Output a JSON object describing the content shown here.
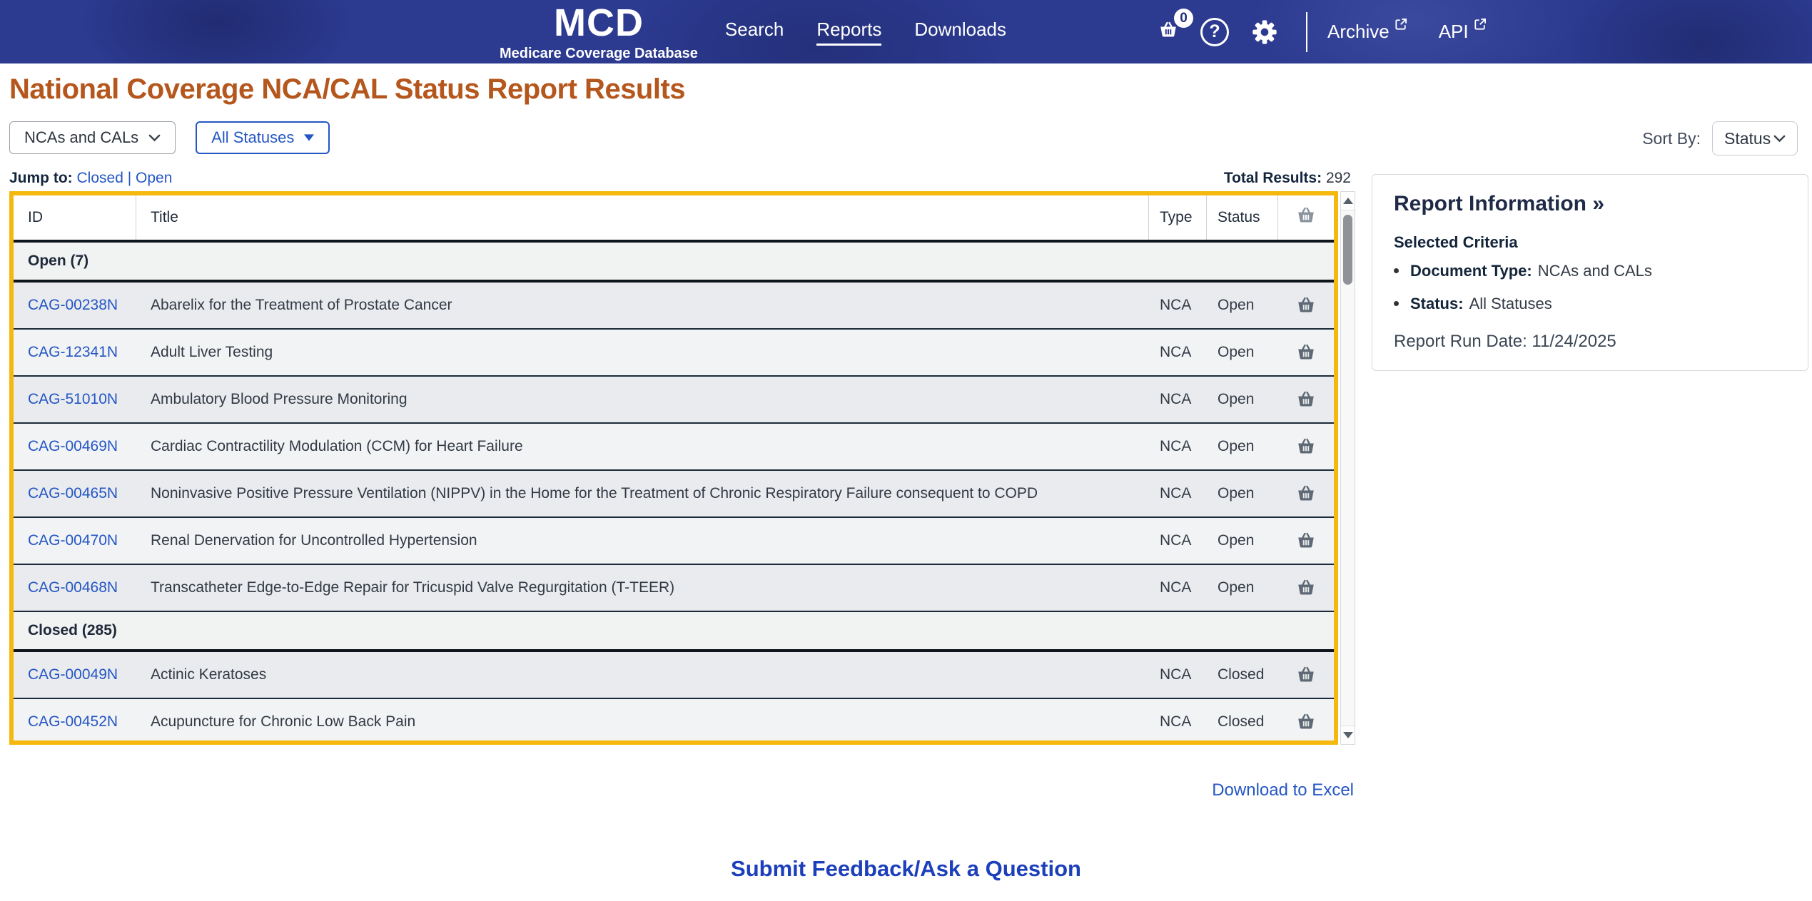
{
  "nav": {
    "logo_title": "MCD",
    "logo_subtitle": "Medicare Coverage Database",
    "links": [
      {
        "label": "Search"
      },
      {
        "label": "Reports"
      },
      {
        "label": "Downloads"
      }
    ],
    "basket_count": "0",
    "archive_label": "Archive",
    "api_label": "API"
  },
  "page": {
    "title": "National Coverage NCA/CAL Status Report Results",
    "doc_type_filter": "NCAs and CALs",
    "status_filter": "All Statuses",
    "sort_by_label": "Sort By:",
    "sort_by_value": "Status",
    "jump_to_label": "Jump to:",
    "jump_closed": "Closed",
    "jump_separator": "|",
    "jump_open": "Open",
    "total_results_label": "Total Results:",
    "total_results_value": "292"
  },
  "table": {
    "columns": [
      "ID",
      "Title",
      "Type",
      "Status"
    ],
    "sections": [
      {
        "header": "Open (7)",
        "rows": [
          {
            "id": "CAG-00238N",
            "title": "Abarelix for the Treatment of Prostate Cancer",
            "type": "NCA",
            "status": "Open"
          },
          {
            "id": "CAG-12341N",
            "title": "Adult Liver Testing",
            "type": "NCA",
            "status": "Open"
          },
          {
            "id": "CAG-51010N",
            "title": "Ambulatory Blood Pressure Monitoring",
            "type": "NCA",
            "status": "Open"
          },
          {
            "id": "CAG-00469N",
            "title": "Cardiac Contractility Modulation (CCM) for Heart Failure",
            "type": "NCA",
            "status": "Open"
          },
          {
            "id": "CAG-00465N",
            "title": "Noninvasive Positive Pressure Ventilation (NIPPV) in the Home for the Treatment of Chronic Respiratory Failure consequent to COPD",
            "type": "NCA",
            "status": "Open"
          },
          {
            "id": "CAG-00470N",
            "title": "Renal Denervation for Uncontrolled Hypertension",
            "type": "NCA",
            "status": "Open"
          },
          {
            "id": "CAG-00468N",
            "title": "Transcatheter Edge-to-Edge Repair for Tricuspid Valve Regurgitation (T-TEER)",
            "type": "NCA",
            "status": "Open"
          }
        ]
      },
      {
        "header": "Closed (285)",
        "rows": [
          {
            "id": "CAG-00049N",
            "title": "Actinic Keratoses",
            "type": "NCA",
            "status": "Closed"
          },
          {
            "id": "CAG-00452N",
            "title": "Acupuncture for Chronic Low Back Pain",
            "type": "NCA",
            "status": "Closed"
          }
        ]
      }
    ]
  },
  "sidebar": {
    "title": "Report Information »",
    "criteria_heading": "Selected Criteria",
    "criteria": [
      {
        "label": "Document Type:",
        "value": "NCAs and CALs"
      },
      {
        "label": "Status:",
        "value": "All Statuses"
      }
    ],
    "run_date": "Report Run Date: 11/24/2025"
  },
  "footer": {
    "download_label": "Download to Excel",
    "feedback_label": "Submit Feedback/Ask a Question"
  },
  "colors": {
    "nav_blue": "#2c3a90",
    "title_orange": "#b5571d",
    "link_blue": "#2456c4",
    "table_border_yellow": "#f5b80c",
    "dark_navy_text": "#14263c",
    "row_gray": "#e9ebee",
    "row_gray_alt": "#f2f3f5"
  }
}
